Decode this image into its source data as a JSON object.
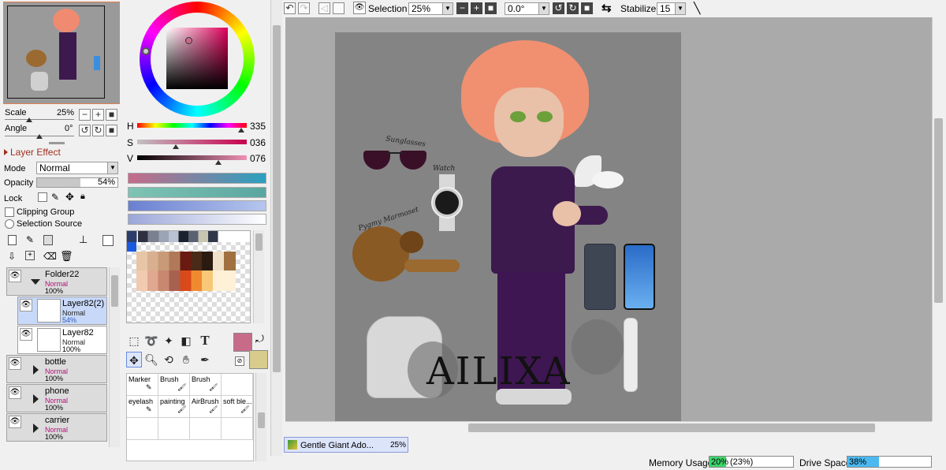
{
  "navigator": {
    "scale_label": "Scale",
    "scale_value": "25%",
    "angle_label": "Angle",
    "angle_value": "0°"
  },
  "layer_effect": {
    "title": "Layer Effect",
    "mode_label": "Mode",
    "mode_value": "Normal",
    "opacity_label": "Opacity",
    "opacity_value": "54%",
    "opacity_fraction": 0.54,
    "lock_label": "Lock",
    "clipping_label": "Clipping Group",
    "selection_source_label": "Selection Source"
  },
  "hsv": {
    "h_label": "H",
    "h_value": "335",
    "s_label": "S",
    "s_value": "036",
    "v_label": "V",
    "v_value": "076",
    "current_color": "#c76b89",
    "secondary_color": "#d8cc8c"
  },
  "layers": [
    {
      "name": "Folder22",
      "mode": "Normal",
      "opacity": "100%",
      "type": "folder"
    },
    {
      "name": "Layer82(2)",
      "mode": "Normal",
      "opacity": "54%",
      "type": "layer",
      "selected": true
    },
    {
      "name": "Layer82",
      "mode": "Normal",
      "opacity": "100%",
      "type": "layer"
    },
    {
      "name": "bottle",
      "mode": "Normal",
      "opacity": "100%",
      "type": "folder"
    },
    {
      "name": "phone",
      "mode": "Normal",
      "opacity": "100%",
      "type": "folder"
    },
    {
      "name": "carrier",
      "mode": "Normal",
      "opacity": "100%",
      "type": "folder"
    }
  ],
  "brushes": [
    {
      "name": "Marker"
    },
    {
      "name": "Brush"
    },
    {
      "name": "Brush"
    },
    {
      "name": "eyelash"
    },
    {
      "name": "painting"
    },
    {
      "name": "AirBrush"
    },
    {
      "name": "soft ble..."
    }
  ],
  "toolbar": {
    "selection_label": "Selection",
    "zoom_value": "25%",
    "rotation_value": "0.0°",
    "stabilizer_label": "Stabilizer",
    "stabilizer_value": "15"
  },
  "canvas_art": {
    "watermark": "AILIXA",
    "labels": [
      "Sunglasses",
      "Watch",
      "Pygmy Marmoset"
    ]
  },
  "document_tab": {
    "name": "Gentle Giant Ado...",
    "zoom": "25%"
  },
  "status": {
    "memory_label": "Memory Usage",
    "memory_value": "20%",
    "memory_paren": "(23%)",
    "memory_fraction": 0.2,
    "drive_label": "Drive Space",
    "drive_value": "38%",
    "drive_fraction": 0.38
  },
  "colors": {
    "accent": "#c76b89",
    "selection_blue": "#c8d8f8",
    "memory_green": "#3ed46b",
    "drive_blue": "#4cb8f0"
  }
}
